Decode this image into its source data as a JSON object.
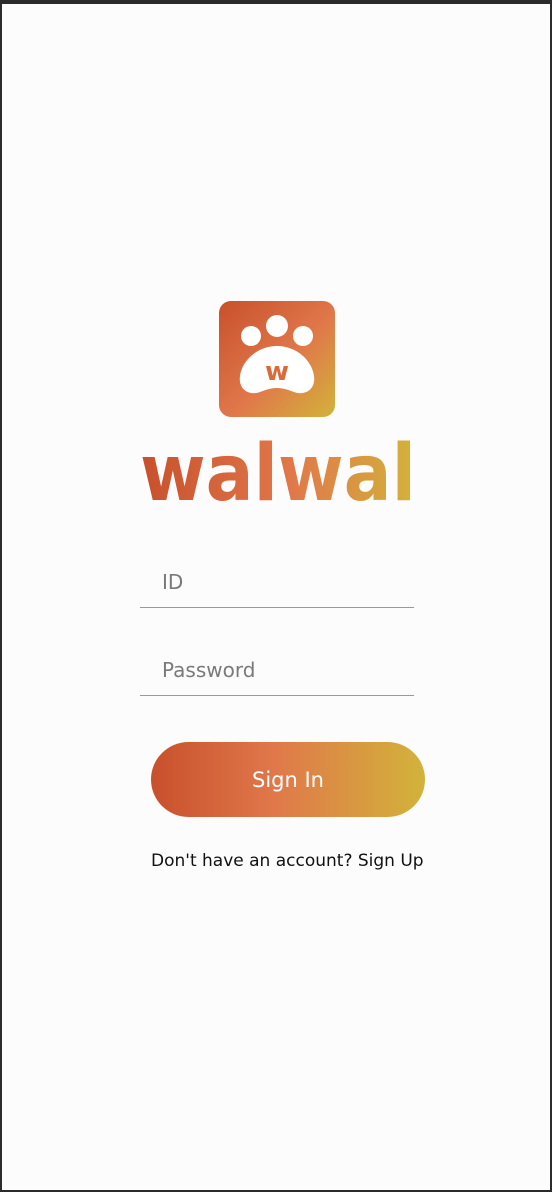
{
  "brand": {
    "logo_icon": "paw-w-icon",
    "wordmark": "walwal",
    "gradient": [
      "#c8502c",
      "#e0784a",
      "#d2b33a"
    ]
  },
  "login": {
    "id_placeholder": "ID",
    "password_placeholder": "Password",
    "signin_label": "Sign In",
    "signup_prompt": "Don't have an account?",
    "signup_link": "Sign Up"
  },
  "colors": {
    "background": "#fcfcfc",
    "text": "#111111",
    "placeholder": "#7a7a7a",
    "underline": "#9a9a9a"
  }
}
